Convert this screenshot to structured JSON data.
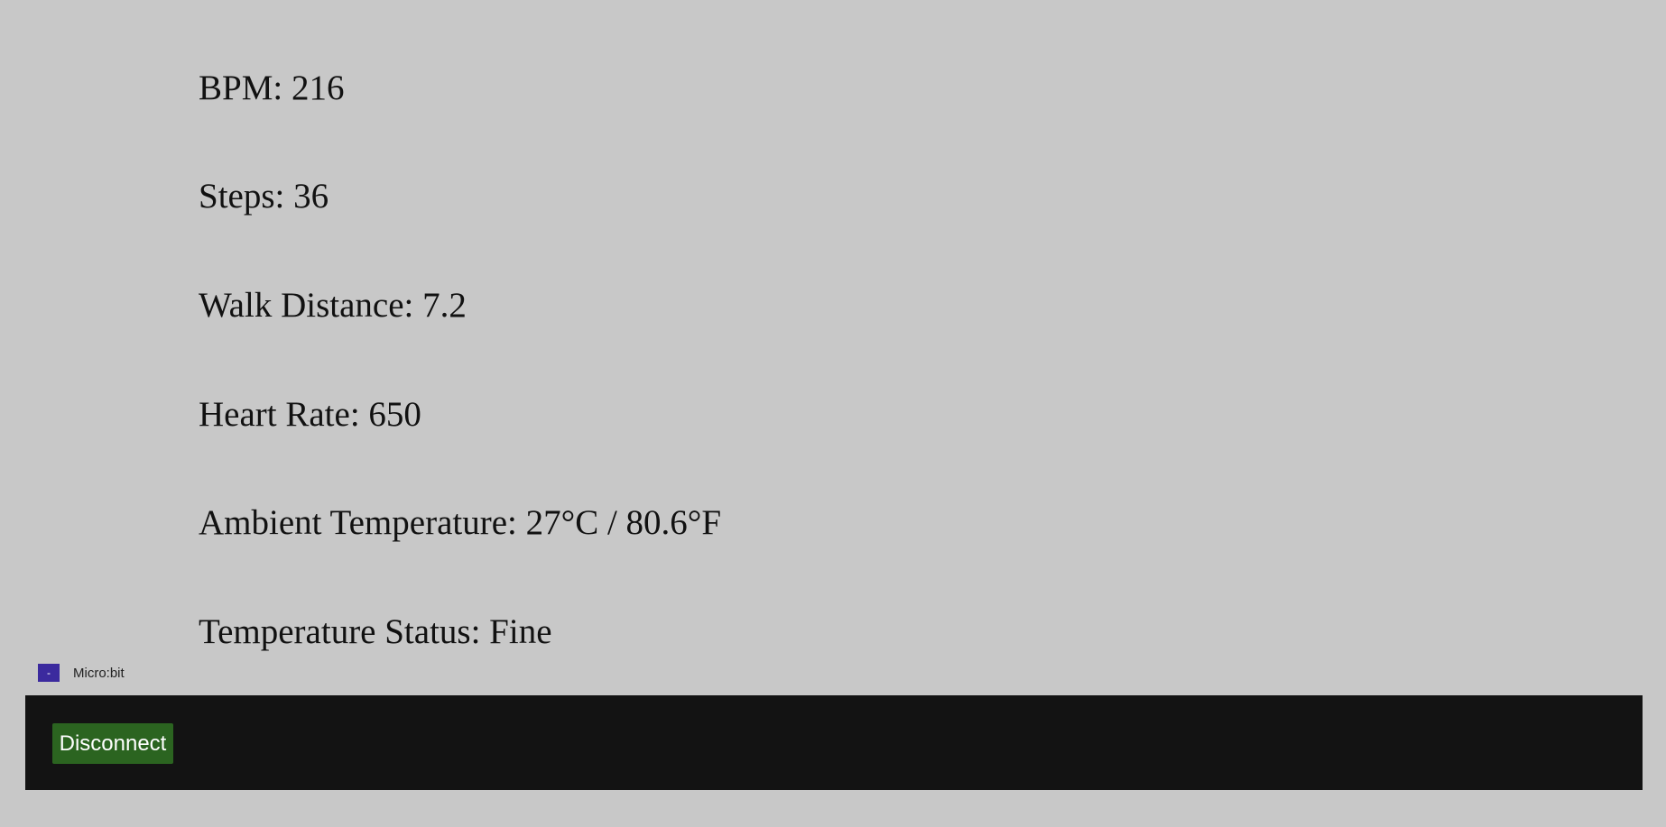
{
  "readings": {
    "bpm": "BPM: 216",
    "steps": "Steps: 36",
    "walk_distance": "Walk Distance: 7.2",
    "heart_rate": "Heart Rate: 650",
    "ambient_temperature": "Ambient Temperature: 27°C / 80.6°F",
    "temperature_status": "Temperature Status: Fine"
  },
  "device": {
    "toggle_label": "-",
    "name": "Micro:bit"
  },
  "panel": {
    "disconnect_label": "Disconnect"
  },
  "colors": {
    "page_background": "#c8c8c8",
    "panel_background": "#131313",
    "disconnect_button": "#2b6420",
    "toggle_button": "#3b2a9e"
  }
}
